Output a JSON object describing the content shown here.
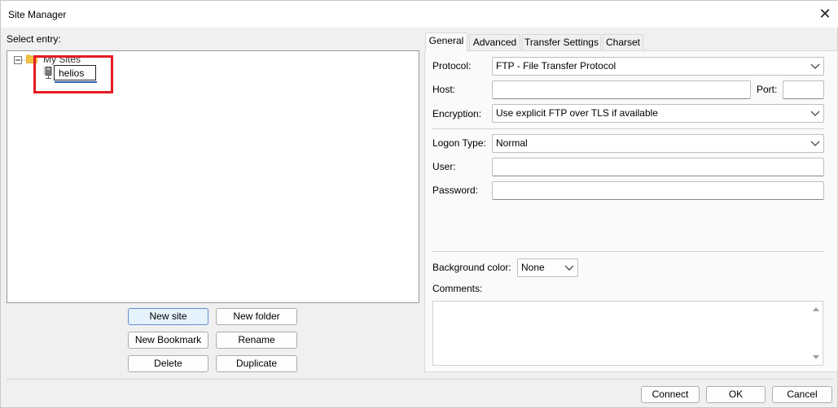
{
  "window": {
    "title": "Site Manager"
  },
  "left": {
    "select_entry_label": "Select entry:",
    "tree": {
      "root_label": "My Sites",
      "editing_value": "helios"
    },
    "buttons": {
      "new_site": "New site",
      "new_folder": "New folder",
      "new_bookmark": "New Bookmark",
      "rename": "Rename",
      "delete": "Delete",
      "duplicate": "Duplicate"
    }
  },
  "tabs": [
    "General",
    "Advanced",
    "Transfer Settings",
    "Charset"
  ],
  "general": {
    "protocol_label": "Protocol:",
    "protocol_value": "FTP - File Transfer Protocol",
    "host_label": "Host:",
    "host_value": "",
    "port_label": "Port:",
    "port_value": "",
    "encryption_label": "Encryption:",
    "encryption_value": "Use explicit FTP over TLS if available",
    "logon_type_label": "Logon Type:",
    "logon_type_value": "Normal",
    "user_label": "User:",
    "user_value": "",
    "password_label": "Password:",
    "password_value": "",
    "background_color_label": "Background color:",
    "background_color_value": "None",
    "comments_label": "Comments:",
    "comments_value": ""
  },
  "footer": {
    "connect": "Connect",
    "ok": "OK",
    "cancel": "Cancel"
  },
  "colors": {
    "highlight_box": "#e31b23",
    "edit_underline": "#2b5fb3",
    "folder": "#f5c242"
  }
}
